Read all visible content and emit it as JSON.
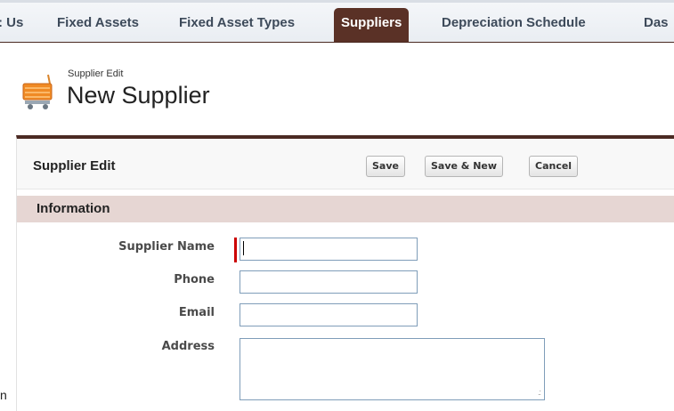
{
  "tabs": [
    {
      "label": ": Us"
    },
    {
      "label": "Fixed Assets"
    },
    {
      "label": "Fixed Asset Types"
    },
    {
      "label": "Suppliers",
      "active": true
    },
    {
      "label": "Depreciation Schedule"
    },
    {
      "label": "Das"
    }
  ],
  "header": {
    "subtitle": "Supplier Edit",
    "title": "New Supplier",
    "icon": "cart-icon"
  },
  "form": {
    "title": "Supplier Edit",
    "buttons": {
      "save": "Save",
      "save_new": "Save & New",
      "cancel": "Cancel"
    },
    "section_title": "Information",
    "fields": {
      "supplier_name": {
        "label": "Supplier Name",
        "value": "",
        "required": true
      },
      "phone": {
        "label": "Phone",
        "value": ""
      },
      "email": {
        "label": "Email",
        "value": ""
      },
      "address": {
        "label": "Address",
        "value": ""
      }
    }
  },
  "stray_text": "n",
  "colors": {
    "active_tab": "#5a3126",
    "accent_bar": "#4b2a22",
    "section_bg": "#e6d6d3",
    "required_marker": "#cc0000"
  }
}
